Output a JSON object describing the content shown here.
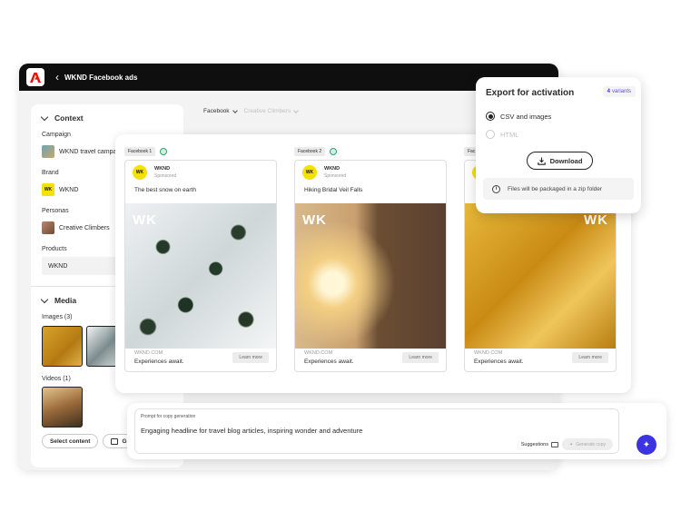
{
  "app": {
    "back_glyph": "‹",
    "title": "WKND Facebook ads"
  },
  "sidebar": {
    "context_title": "Context",
    "campaign_label": "Campaign",
    "campaign_value": "WKND travel campaign",
    "brand_label": "Brand",
    "brand_value": "WKND",
    "brand_logo_text": "WK",
    "personas_label": "Personas",
    "personas_value": "Creative Climbers",
    "products_label": "Products",
    "products_value": "WKND",
    "media_title": "Media",
    "images_label": "Images (3)",
    "videos_label": "Videos (1)",
    "select_content": "Select content",
    "generate_partial": "G"
  },
  "breadcrumb": {
    "channel": "Facebook",
    "persona": "Creative Climbers"
  },
  "cards": [
    {
      "tag": "Facebook 1",
      "brand": "WKND",
      "sponsored": "Sponsored",
      "logo": "WK",
      "headline": "The best snow on earth",
      "overlay": "WK",
      "site": "WKND.COM",
      "tagline": "Experiences await.",
      "cta": "Learn more"
    },
    {
      "tag": "Facebook 2",
      "brand": "WKND",
      "sponsored": "Sponsored",
      "logo": "WK",
      "headline": "Hiking Bridal Veil Falls",
      "overlay": "WK",
      "site": "WKND.COM",
      "tagline": "Experiences await.",
      "cta": "Learn more"
    },
    {
      "tag": "Fac",
      "brand": "",
      "sponsored": "",
      "logo": "WK",
      "headline": "",
      "overlay": "WK",
      "site": "WKND.COM",
      "tagline": "Experiences await.",
      "cta": "Learn more"
    }
  ],
  "prompt": {
    "label": "Prompt for copy generation",
    "text": "Engaging headline for travel blog articles, inspiring wonder and adventure",
    "suggestions": "Suggestions",
    "generate": "Generate copy"
  },
  "export": {
    "title": "Export for activation",
    "variants_count": "4",
    "variants_label": "variants",
    "option_csv": "CSV and images",
    "option_html": "HTML",
    "download": "Download",
    "info": "Files will be packaged in a zip folder"
  },
  "colors": {
    "accent": "#3b34e0",
    "brand_yellow": "#f5e000",
    "logo_red": "#eb1000"
  }
}
